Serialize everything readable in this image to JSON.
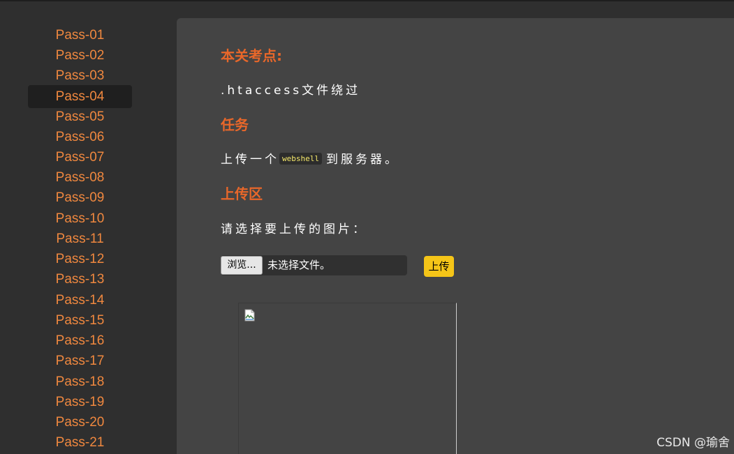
{
  "sidebar": {
    "items": [
      {
        "label": "Pass-01"
      },
      {
        "label": "Pass-02"
      },
      {
        "label": "Pass-03"
      },
      {
        "label": "Pass-04",
        "active": true
      },
      {
        "label": "Pass-05"
      },
      {
        "label": "Pass-06"
      },
      {
        "label": "Pass-07"
      },
      {
        "label": "Pass-08"
      },
      {
        "label": "Pass-09"
      },
      {
        "label": "Pass-10"
      },
      {
        "label": "Pass-11"
      },
      {
        "label": "Pass-12"
      },
      {
        "label": "Pass-13"
      },
      {
        "label": "Pass-14"
      },
      {
        "label": "Pass-15"
      },
      {
        "label": "Pass-16"
      },
      {
        "label": "Pass-17"
      },
      {
        "label": "Pass-18"
      },
      {
        "label": "Pass-19"
      },
      {
        "label": "Pass-20"
      },
      {
        "label": "Pass-21"
      }
    ]
  },
  "main": {
    "point_heading": "本关考点:",
    "point_text": ".htaccess文件绕过",
    "task_heading": "任务",
    "task_text_before": "上传一个",
    "task_code": "webshell",
    "task_text_after": "到服务器。",
    "upload_heading": "上传区",
    "upload_prompt": "请选择要上传的图片：",
    "browse_label": "浏览...",
    "file_status": "未选择文件。",
    "upload_button": "上传",
    "preview_icon": "broken-image-icon"
  },
  "watermark": "CSDN @瑜舍",
  "colors": {
    "accent_orange": "#e8672a",
    "sidebar_link": "#f0883f",
    "upload_button": "#f5c518",
    "code_text": "#f4e76a"
  }
}
